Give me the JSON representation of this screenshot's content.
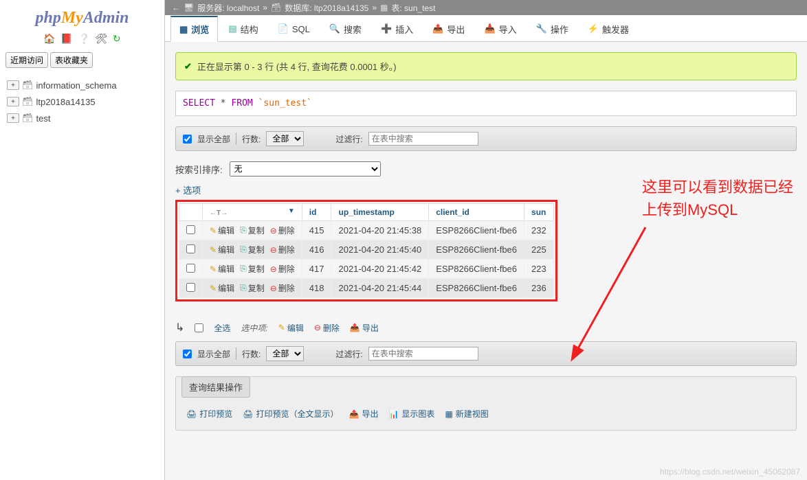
{
  "logo": {
    "part1": "php",
    "part2": "My",
    "part3": "Admin"
  },
  "sidebar": {
    "btn_recent": "近期访问",
    "btn_favorites": "表收藏夹",
    "databases": [
      {
        "name": "information_schema"
      },
      {
        "name": "ltp2018a14135"
      },
      {
        "name": "test"
      }
    ]
  },
  "breadcrumb": {
    "server_label": "服务器:",
    "server_value": "localhost",
    "db_label": "数据库:",
    "db_value": "ltp2018a14135",
    "table_label": "表:",
    "table_value": "sun_test"
  },
  "tabs": {
    "browse": "浏览",
    "structure": "结构",
    "sql": "SQL",
    "search": "搜索",
    "insert": "插入",
    "export": "导出",
    "import": "导入",
    "operations": "操作",
    "triggers": "触发器"
  },
  "success_msg": "正在显示第 0 - 3 行 (共 4 行, 查询花费 0.0001 秒。)",
  "sql": {
    "select": "SELECT",
    "star": "*",
    "from": "FROM",
    "table": "`sun_test`"
  },
  "toolbar": {
    "show_all": "显示全部",
    "rows_label": "行数:",
    "rows_value": "全部",
    "filter_label": "过滤行:",
    "filter_placeholder": "在表中搜索"
  },
  "sort": {
    "label": "按索引排序:",
    "value": "无"
  },
  "options_label": "+ 选项",
  "actions": {
    "edit": "编辑",
    "copy": "复制",
    "delete": "删除"
  },
  "columns": {
    "id": "id",
    "up_timestamp": "up_timestamp",
    "client_id": "client_id",
    "sun": "sun"
  },
  "chart_data": {
    "type": "table",
    "columns": [
      "id",
      "up_timestamp",
      "client_id",
      "sun"
    ],
    "rows": [
      {
        "id": "415",
        "up_timestamp": "2021-04-20 21:45:38",
        "client_id": "ESP8266Client-fbe6",
        "sun": "232"
      },
      {
        "id": "416",
        "up_timestamp": "2021-04-20 21:45:40",
        "client_id": "ESP8266Client-fbe6",
        "sun": "225"
      },
      {
        "id": "417",
        "up_timestamp": "2021-04-20 21:45:42",
        "client_id": "ESP8266Client-fbe6",
        "sun": "223"
      },
      {
        "id": "418",
        "up_timestamp": "2021-04-20 21:45:44",
        "client_id": "ESP8266Client-fbe6",
        "sun": "236"
      }
    ]
  },
  "bulk": {
    "select_all": "全选",
    "with_selected": "选中项:",
    "edit": "编辑",
    "delete": "删除",
    "export": "导出"
  },
  "fieldset": {
    "title": "查询结果操作",
    "print_preview": "打印预览",
    "print_full": "打印预览（全文显示）",
    "export": "导出",
    "chart": "显示图表",
    "create_view": "新建视图"
  },
  "annotation": {
    "line1": "这里可以看到数据已经",
    "line2": "上传到MySQL"
  },
  "watermark": "https://blog.csdn.net/weixin_45062087"
}
